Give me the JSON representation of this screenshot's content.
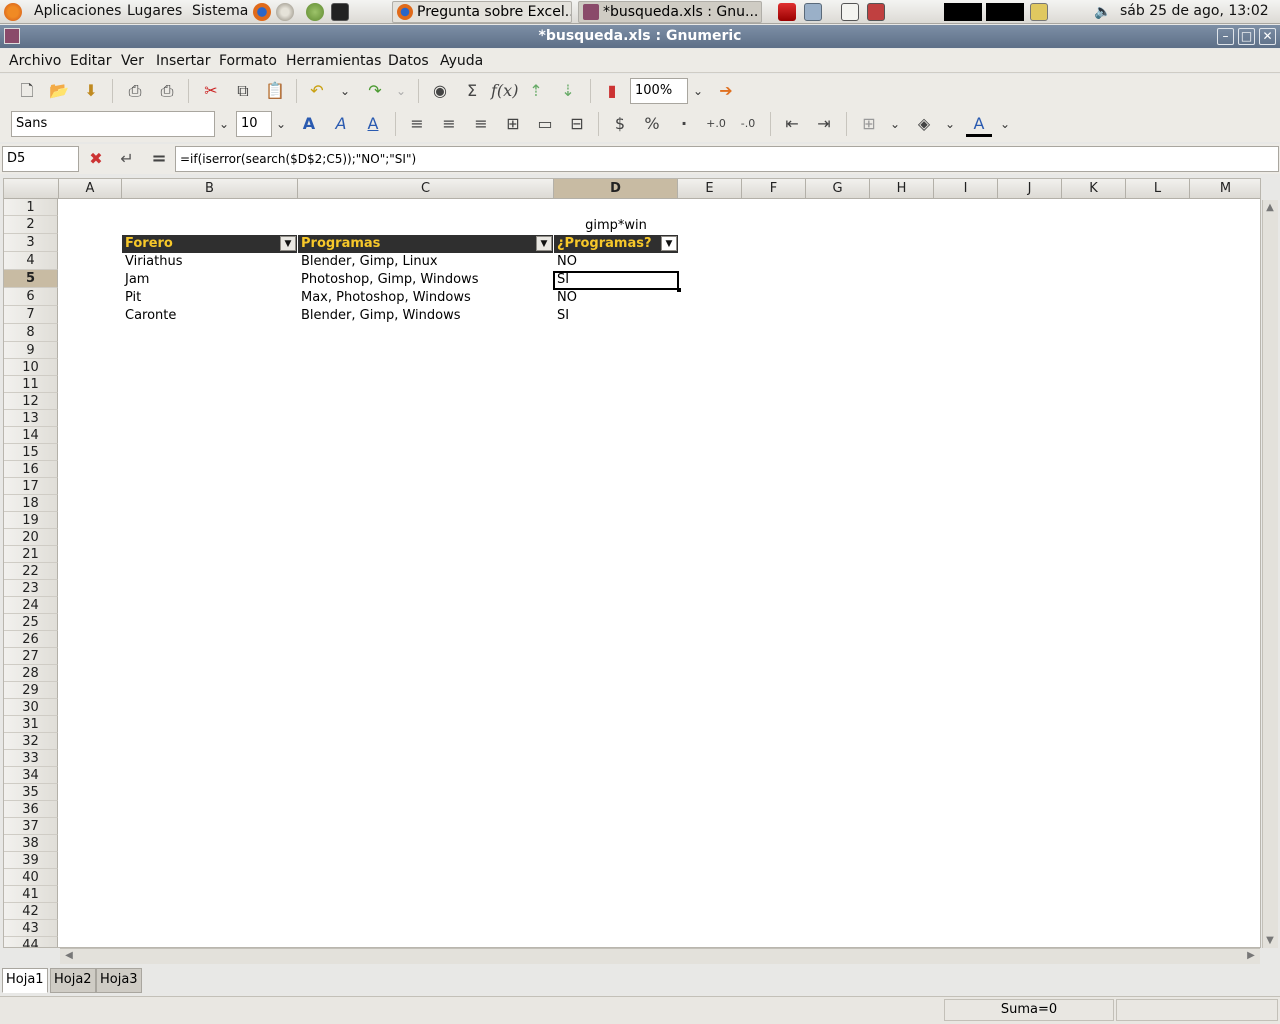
{
  "panel": {
    "menus": [
      "Aplicaciones",
      "Lugares",
      "Sistema"
    ],
    "tasks": [
      {
        "label": "Pregunta sobre Excel...",
        "active": false
      },
      {
        "label": "*busqueda.xls : Gnu...",
        "active": true
      }
    ],
    "clock": "sáb 25 de ago, 13:02"
  },
  "window": {
    "title": "*busqueda.xls : Gnumeric",
    "minimize": "–",
    "maximize": "□",
    "close": "✕"
  },
  "menubar": [
    "Archivo",
    "Editar",
    "Ver",
    "Insertar",
    "Formato",
    "Herramientas",
    "Datos",
    "Ayuda"
  ],
  "toolbar": {
    "zoom": "100%",
    "font_name": "Sans",
    "font_size": "10"
  },
  "formula_bar": {
    "cell_ref": "D5",
    "formula": "=if(iserror(search($D$2;C5));\"NO\";\"SI\")",
    "equals": "="
  },
  "columns": [
    "A",
    "B",
    "C",
    "D",
    "E",
    "F",
    "G",
    "H",
    "I",
    "J",
    "K",
    "L",
    "M"
  ],
  "selected_column": "D",
  "selected_row": 5,
  "sheet": {
    "d2": "gimp*win",
    "headers": [
      "Forero",
      "Programas",
      "¿Programas?"
    ],
    "rows": [
      [
        "Viriathus",
        "Blender, Gimp, Linux",
        "NO"
      ],
      [
        "Jam",
        "Photoshop, Gimp, Windows",
        "SI"
      ],
      [
        "Pit",
        "Max, Photoshop, Windows",
        "NO"
      ],
      [
        "Caronte",
        "Blender, Gimp, Windows",
        "SI"
      ]
    ]
  },
  "tabs": [
    "Hoja1",
    "Hoja2",
    "Hoja3"
  ],
  "status": {
    "sum": "Suma=0"
  }
}
